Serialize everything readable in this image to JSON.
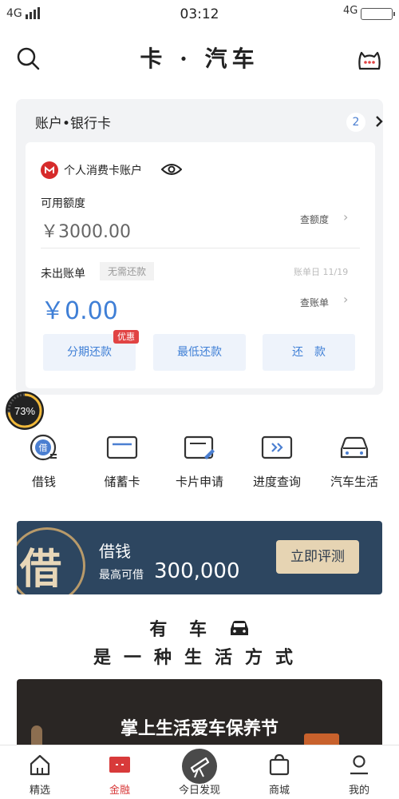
{
  "status_bar": {
    "network_left": "4G",
    "time": "03:12",
    "network_right": "4G"
  },
  "header": {
    "title": "卡 · 汽车"
  },
  "account_card": {
    "title": "账户•银行卡",
    "count": "2",
    "account_name": "个人消费卡账户",
    "available_label": "可用额度",
    "available_amount": "￥3000.00",
    "view_limit_link": "查额度",
    "unbilled_label": "未出账单",
    "no_repay_tag": "无需还款",
    "bill_date": "账单日 11/19",
    "unbilled_amount": "￥0.00",
    "view_bill_link": "查账单",
    "buttons": {
      "installment": "分期还款",
      "minimum": "最低还款",
      "repay": "还　款"
    },
    "promo_badge": "优惠"
  },
  "progress": {
    "percent": 73,
    "label": "73%"
  },
  "shortcuts": [
    {
      "label": "借钱",
      "icon": "borrow-icon"
    },
    {
      "label": "储蓄卡",
      "icon": "debit-card-icon"
    },
    {
      "label": "卡片申请",
      "icon": "card-apply-icon"
    },
    {
      "label": "进度查询",
      "icon": "progress-query-icon"
    },
    {
      "label": "汽车生活",
      "icon": "car-icon"
    }
  ],
  "loan_banner": {
    "big_char": "借",
    "title": "借钱",
    "subtitle": "最高可借",
    "amount": "300,000",
    "button": "立即评测"
  },
  "slogan": {
    "line1_a": "有 车",
    "line2": "是一种生活方式"
  },
  "promo_banner": {
    "title": "掌上生活爱车保养节"
  },
  "tabs": [
    {
      "label": "精选",
      "icon": "home-icon"
    },
    {
      "label": "金融",
      "icon": "finance-icon",
      "active": true
    },
    {
      "label": "今日发现",
      "icon": "telescope-icon"
    },
    {
      "label": "商城",
      "icon": "shopping-bag-icon"
    },
    {
      "label": "我的",
      "icon": "profile-icon"
    }
  ],
  "colors": {
    "accent_blue": "#3f7fd6",
    "active_red": "#d83a3a",
    "banner_navy": "#2d4660",
    "gold": "#e6d4b3"
  }
}
